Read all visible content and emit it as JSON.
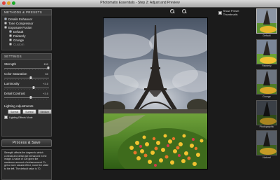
{
  "window": {
    "title": "Photomatix Essentials - Step 2: Adjust and Preview"
  },
  "methods": {
    "heading": "METHODS & PRESETS",
    "options": [
      {
        "label": "Details Enhancer",
        "checked": true
      },
      {
        "label": "Tone Compressor",
        "checked": false
      },
      {
        "label": "Exposure Fusion",
        "checked": false
      }
    ],
    "sub_options": [
      {
        "label": "Default",
        "checked": true,
        "disabled": false
      },
      {
        "label": "Painterly",
        "checked": false,
        "disabled": false
      },
      {
        "label": "Grunge",
        "checked": false,
        "disabled": false
      },
      {
        "label": "Custom",
        "checked": false,
        "disabled": true
      }
    ]
  },
  "settings": {
    "heading": "SETTINGS",
    "sliders": [
      {
        "label": "Strength",
        "value": "100",
        "position": 0.98
      },
      {
        "label": "Color Saturation",
        "value": "60",
        "position": 0.6
      },
      {
        "label": "Luminosity",
        "value": "+3.0",
        "position": 0.65
      },
      {
        "label": "Detail Contrast",
        "value": "+3.0",
        "position": 0.6
      }
    ],
    "lighting": {
      "label": "Lighting Adjustments",
      "buttons": [
        {
          "label": "Surreal",
          "selected": false
        },
        {
          "label": "Surreal",
          "selected": false
        },
        {
          "label": "Medium",
          "selected": true
        }
      ],
      "checkbox": {
        "label": "Lighting Effects Mode",
        "checked": true
      }
    }
  },
  "process_button": "Process & Save",
  "help_text": "Strength affects the degree to which contrast and detail are enhanced in the image. A value of 100 gives the maximum amount of enhancement. To get a more natural effect, move the slider to the left. The default value is 70.",
  "toolbar": {
    "zoom_in_icon": "zoom-in-icon",
    "zoom_out_icon": "zoom-out-icon",
    "show_thumbnails": {
      "label": "Show Preset Thumbnails",
      "checked": true
    }
  },
  "thumbnails": [
    {
      "label": "Default",
      "selected": true
    },
    {
      "label": "Painterly",
      "selected": false
    },
    {
      "label": "Grunge",
      "selected": false
    },
    {
      "label": "Photographic",
      "selected": false
    },
    {
      "label": "Natural",
      "selected": false
    }
  ],
  "colors": {
    "background": "#1b1b1b",
    "panel": "#2e2e2e",
    "accent": "#2a6fd6"
  }
}
